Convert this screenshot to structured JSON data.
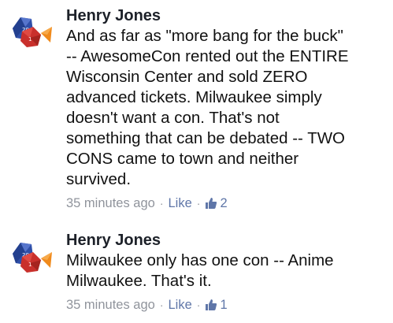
{
  "comments": [
    {
      "author": "Henry Jones",
      "lines": [
        "And as far as \"more bang for the buck\"",
        "-- AwesomeCon rented out the ENTIRE",
        "Wisconsin Center and sold ZERO",
        "advanced tickets. Milwaukee simply",
        "doesn't want a con. That's not",
        "something that can be debated -- TWO",
        "CONS came to town and neither",
        "survived."
      ],
      "timestamp": "35 minutes ago",
      "like_label": "Like",
      "separator": "·",
      "like_count": "2"
    },
    {
      "author": "Henry Jones",
      "lines": [
        "Milwaukee only has one con -- Anime",
        "Milwaukee. That's it."
      ],
      "timestamp": "35 minutes ago",
      "like_label": "Like",
      "separator": "·",
      "like_count": "1"
    }
  ],
  "colors": {
    "author": "#1d2129",
    "meta": "#90949c",
    "like_link": "#5f76a8",
    "thumb": "#5f76a8"
  },
  "icons": {
    "avatar": "dice-avatar-icon",
    "like": "thumbs-up-icon"
  }
}
